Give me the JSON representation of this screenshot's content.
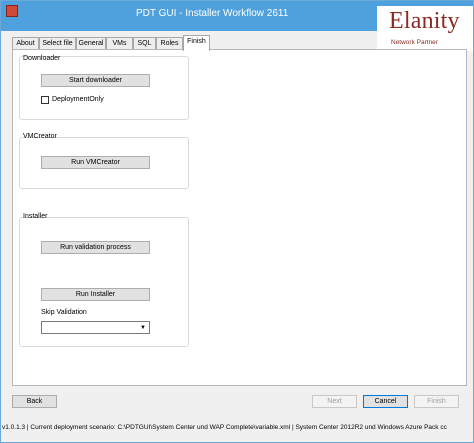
{
  "window": {
    "title": "PDT GUI -  Installer Workflow 2611"
  },
  "logo": {
    "name": "Elanity",
    "tagline": "Network Partner"
  },
  "tabs": [
    "About",
    "Select file",
    "General",
    "VMs",
    "SQL",
    "Roles",
    "Finish"
  ],
  "active_tab": "Finish",
  "downloader": {
    "label": "Downloader",
    "start_button": "Start downloader",
    "deployment_only_label": "DeploymentOnly",
    "deployment_only_checked": false
  },
  "vmcreator": {
    "label": "VMCreator",
    "run_button": "Run VMCreator"
  },
  "installer": {
    "label": "Installer",
    "validation_button": "Run validation process",
    "run_button": "Run Installer",
    "skip_validation_label": "Skip Validation",
    "skip_validation_value": ""
  },
  "nav": {
    "back": "Back",
    "next": "Next",
    "cancel": "Cancel",
    "finish": "Finish"
  },
  "status": "v1.0.1.3 | Current deployment scenario: C:\\PDTGUI\\System Center und WAP Complete\\variable.xml | System Center 2012R2 und Windows Azure Pack cc"
}
